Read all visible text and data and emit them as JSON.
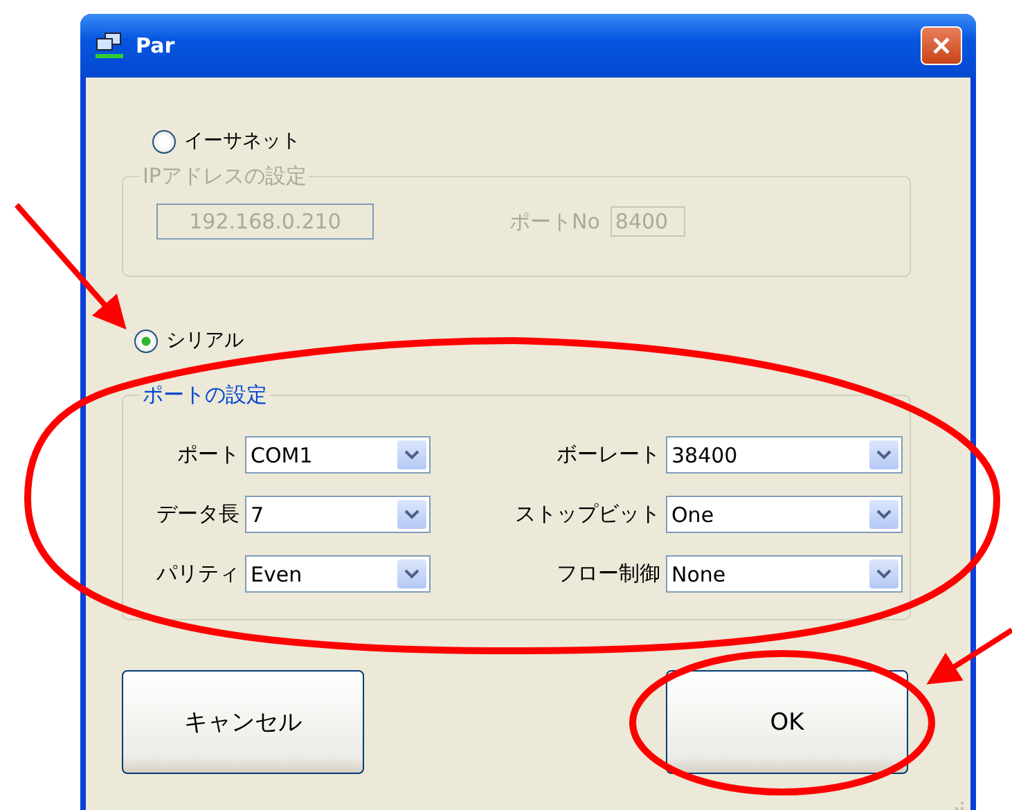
{
  "window": {
    "title": "Par"
  },
  "connections": [
    {
      "kind": "ethernet",
      "label": "イーサネット",
      "selected": false,
      "group": {
        "legend": "IPアドレスの設定",
        "disabled": true,
        "ip_address": "192.168.0.210",
        "port_label": "ポートNo",
        "port": "8400"
      }
    },
    {
      "kind": "serial",
      "label": "シリアル",
      "selected": true,
      "group": {
        "legend": "ポートの設定",
        "disabled": false,
        "fields": [
          {
            "label": "ポート",
            "value": "COM1"
          },
          {
            "label": "ボーレート",
            "value": "38400"
          },
          {
            "label": "データ長",
            "value": "7"
          },
          {
            "label": "ストップビット",
            "value": "One"
          },
          {
            "label": "パリティ",
            "value": "Even"
          },
          {
            "label": "フロー制御",
            "value": "None"
          }
        ]
      }
    }
  ],
  "buttons": [
    {
      "label": "キャンセル"
    },
    {
      "label": "OK"
    }
  ]
}
